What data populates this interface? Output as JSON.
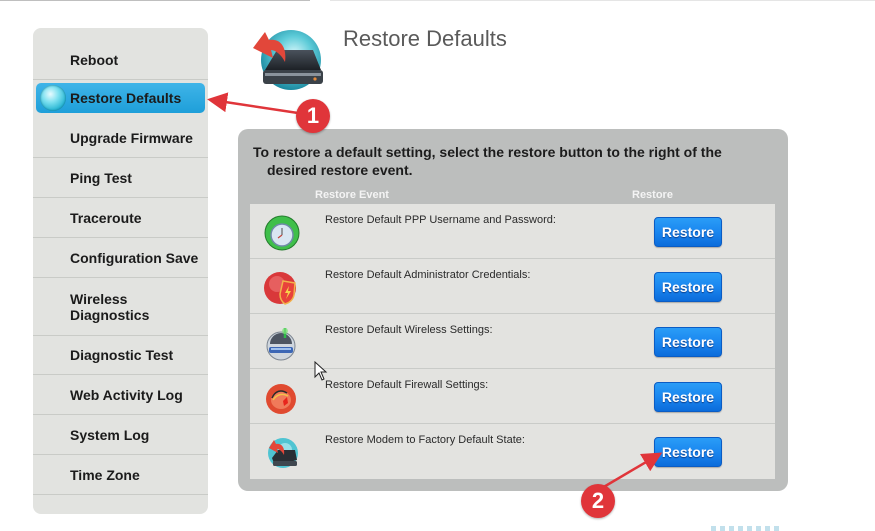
{
  "sidebar": {
    "items": [
      {
        "label": "Reboot",
        "active": false
      },
      {
        "label": "Restore Defaults",
        "active": true
      },
      {
        "label": "Upgrade Firmware",
        "active": false
      },
      {
        "label": "Ping Test",
        "active": false
      },
      {
        "label": "Traceroute",
        "active": false
      },
      {
        "label": "Configuration Save",
        "active": false
      },
      {
        "label": "Wireless Diagnostics",
        "active": false
      },
      {
        "label": "Diagnostic Test",
        "active": false
      },
      {
        "label": "Web Activity Log",
        "active": false
      },
      {
        "label": "System Log",
        "active": false
      },
      {
        "label": "Time Zone",
        "active": false
      }
    ]
  },
  "header": {
    "title": "Restore Defaults",
    "icon": "restore-drive-icon"
  },
  "panel": {
    "description_line1": "To restore a default setting, select the restore button to the right of the",
    "description_line2": "desired restore event.",
    "columns": {
      "event": "Restore Event",
      "restore": "Restore"
    },
    "rows": [
      {
        "icon": "clock-icon",
        "label": "Restore Default PPP Username and Password:",
        "button": "Restore"
      },
      {
        "icon": "shield-icon",
        "label": "Restore Default Administrator Credentials:",
        "button": "Restore"
      },
      {
        "icon": "wireless-router-icon",
        "label": "Restore Default Wireless Settings:",
        "button": "Restore"
      },
      {
        "icon": "firewall-icon",
        "label": "Restore Default Firewall Settings:",
        "button": "Restore"
      },
      {
        "icon": "restore-drive-icon",
        "label": "Restore Modem to Factory Default State:",
        "button": "Restore"
      }
    ]
  },
  "annotations": {
    "badge1": "1",
    "badge2": "2",
    "color": "#e0353a"
  }
}
